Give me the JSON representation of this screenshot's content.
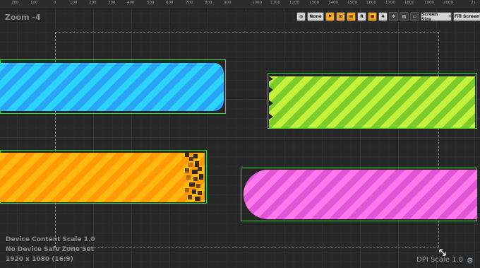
{
  "ruler": {
    "labels": [
      "200",
      "100",
      "0",
      "100",
      "200",
      "300",
      "400",
      "500",
      "600",
      "700",
      "800",
      "900",
      "1000",
      "1100",
      "1200",
      "1300",
      "1400",
      "1500",
      "1600",
      "1700",
      "1800",
      "1900",
      "2000",
      "21"
    ]
  },
  "viewport": {
    "zoom_label": "Zoom -4",
    "device_content_scale": "Device Content Scale 1.0",
    "safe_zone": "No Device Safe Zone Set",
    "resolution": "1920 x 1080 (16:9)",
    "dpi_scale": "DPI Scale 1.0"
  },
  "toolbar": {
    "none_label": "None",
    "r_label": "R",
    "grid_value": "4",
    "screen_size_label": "Screen Size",
    "fill_screen_label": "Fill Screen"
  },
  "colors": {
    "selection_outline": "#2de02d",
    "blue_bar": "#2ad4ff",
    "lime_bar": "#c4f23a",
    "orange_bar": "#ffb80f",
    "pink_bar": "#ff79ec",
    "toolbar_active": "#f7a61f"
  }
}
